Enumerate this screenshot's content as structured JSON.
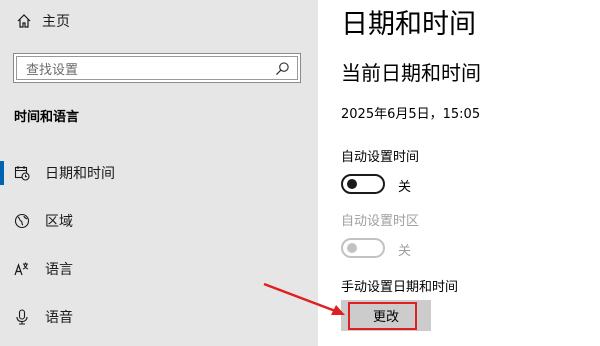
{
  "sidebar": {
    "home_label": "主页",
    "search_placeholder": "查找设置",
    "section_title": "时间和语言",
    "items": [
      {
        "label": "日期和时间",
        "icon": "calendar-clock-icon",
        "active": true
      },
      {
        "label": "区域",
        "icon": "globe-icon",
        "active": false
      },
      {
        "label": "语言",
        "icon": "language-icon",
        "active": false
      },
      {
        "label": "语音",
        "icon": "microphone-icon",
        "active": false
      }
    ]
  },
  "main": {
    "page_title": "日期和时间",
    "section_title": "当前日期和时间",
    "current_datetime": "2025年6月5日，15:05",
    "auto_time": {
      "label": "自动设置时间",
      "state": "关",
      "on": false
    },
    "auto_timezone": {
      "label": "自动设置时区",
      "state": "关",
      "on": false,
      "disabled": true
    },
    "manual": {
      "label": "手动设置日期和时间",
      "button_label": "更改"
    }
  },
  "colors": {
    "accent": "#0063b1",
    "annotation": "#e02020",
    "sidebar_bg": "#e6e6e6",
    "button_bg": "#cccccc"
  }
}
